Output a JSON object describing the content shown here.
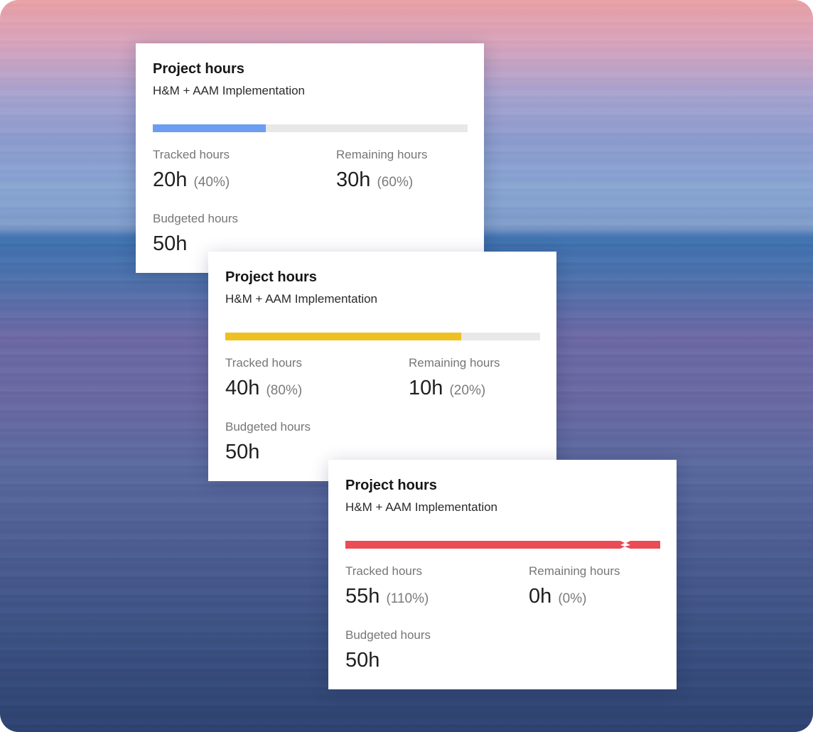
{
  "colors": {
    "track": "#e8e8e8",
    "on_track": "#6c9df1",
    "warning": "#eec021",
    "over_budget": "#ea4b55"
  },
  "cards": [
    {
      "title": "Project hours",
      "subtitle": "H&M + AAM Implementation",
      "progress": 0.36,
      "bar_color": "#6c9df1",
      "over_budget": false,
      "tracked": {
        "label": "Tracked hours",
        "value": "20h",
        "percent": "(40%)"
      },
      "remaining": {
        "label": "Remaining hours",
        "value": "30h",
        "percent": "(60%)"
      },
      "budget": {
        "label": "Budgeted hours",
        "value": "50h"
      }
    },
    {
      "title": "Project hours",
      "subtitle": "H&M + AAM Implementation",
      "progress": 0.75,
      "bar_color": "#eec021",
      "over_budget": false,
      "tracked": {
        "label": "Tracked hours",
        "value": "40h",
        "percent": "(80%)"
      },
      "remaining": {
        "label": "Remaining hours",
        "value": "10h",
        "percent": "(20%)"
      },
      "budget": {
        "label": "Budgeted hours",
        "value": "50h"
      }
    },
    {
      "title": "Project hours",
      "subtitle": "H&M + AAM Implementation",
      "progress": 1.0,
      "bar_color": "#ea4b55",
      "over_budget": true,
      "overflow_break_at": 0.89,
      "tracked": {
        "label": "Tracked hours",
        "value": "55h",
        "percent": "(110%)"
      },
      "remaining": {
        "label": "Remaining hours",
        "value": "0h",
        "percent": "(0%)"
      },
      "budget": {
        "label": "Budgeted hours",
        "value": "50h"
      }
    }
  ]
}
